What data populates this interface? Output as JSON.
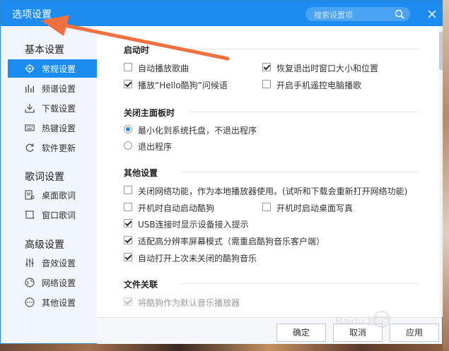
{
  "window": {
    "title": "选项设置",
    "search_placeholder": "搜索设置项",
    "accent_color": "#1c8cf0"
  },
  "sidebar": {
    "groups": [
      {
        "title": "基本设置",
        "items": [
          {
            "label": "常规设置",
            "icon": "gear-icon",
            "active": true
          },
          {
            "label": "频谱设置",
            "icon": "spectrum-icon"
          },
          {
            "label": "下载设置",
            "icon": "download-icon"
          },
          {
            "label": "热键设置",
            "icon": "keyboard-icon"
          },
          {
            "label": "软件更新",
            "icon": "update-icon"
          }
        ]
      },
      {
        "title": "歌词设置",
        "items": [
          {
            "label": "桌面歌词",
            "icon": "desktop-lyrics-icon"
          },
          {
            "label": "窗口歌词",
            "icon": "window-lyrics-icon"
          }
        ]
      },
      {
        "title": "高级设置",
        "items": [
          {
            "label": "音效设置",
            "icon": "equalizer-icon"
          },
          {
            "label": "网络设置",
            "icon": "network-icon"
          },
          {
            "label": "其他设置",
            "icon": "more-icon"
          }
        ]
      }
    ]
  },
  "sections": {
    "startup": {
      "title": "启动时",
      "options": [
        {
          "label": "自动播放歌曲",
          "checked": false
        },
        {
          "label": "恢复退出时窗口大小和位置",
          "checked": true
        },
        {
          "label": "播放“Hello酷狗”问候语",
          "checked": true
        },
        {
          "label": "开启手机遥控电脑播歌",
          "checked": false
        }
      ]
    },
    "close_panel": {
      "title": "关闭主面板时",
      "options": [
        {
          "label": "最小化到系统托盘，不退出程序",
          "selected": true
        },
        {
          "label": "退出程序",
          "selected": false
        }
      ]
    },
    "other": {
      "title": "其他设置",
      "options": [
        {
          "label": "关闭网络功能，作为本地播放器使用。(试听和下载会重新打开网络功能)",
          "checked": false
        },
        {
          "label": "开机时自动启动酷狗",
          "checked": false
        },
        {
          "label": "开机时启动桌面写真",
          "checked": false
        },
        {
          "label": "USB连接时显示设备接入提示",
          "checked": true
        },
        {
          "label": "适配高分辨率屏幕模式（需重启酷狗音乐客户端）",
          "checked": true
        },
        {
          "label": "自动打开上次未关闭的酷狗音乐",
          "checked": true
        }
      ]
    },
    "file_assoc": {
      "title": "文件关联",
      "options": [
        {
          "label": "将酷狗作为默认音乐播放器",
          "checked": true,
          "disabled": true
        }
      ]
    }
  },
  "footer": {
    "ok_label": "确定",
    "cancel_label": "取消",
    "apply_label": "应用"
  },
  "watermark": {
    "text": "Baidu 经验"
  },
  "annotation": {
    "arrow_color": "#f07040"
  }
}
